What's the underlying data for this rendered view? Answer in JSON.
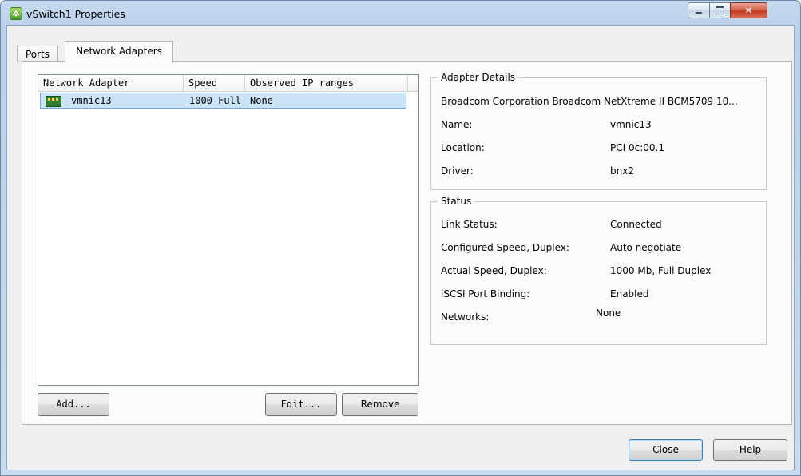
{
  "window": {
    "title": "vSwitch1 Properties"
  },
  "tabs": [
    {
      "label": "Ports",
      "selected": false
    },
    {
      "label": "Network Adapters",
      "selected": true
    }
  ],
  "adapter_list": {
    "columns": [
      "Network Adapter",
      "Speed",
      "Observed IP ranges"
    ],
    "rows": [
      {
        "adapter": "vmnic13",
        "speed": "1000 Full",
        "observed_ip": "None",
        "selected": true
      }
    ]
  },
  "list_buttons": {
    "add": "Add...",
    "edit": "Edit...",
    "remove": "Remove"
  },
  "adapter_details": {
    "title": "Adapter Details",
    "description": "Broadcom Corporation Broadcom NetXtreme II BCM5709 10...",
    "fields": [
      {
        "label": "Name:",
        "value": "vmnic13"
      },
      {
        "label": "Location:",
        "value": "PCI 0c:00.1"
      },
      {
        "label": "Driver:",
        "value": "bnx2"
      }
    ]
  },
  "status": {
    "title": "Status",
    "fields": [
      {
        "label": "Link Status:",
        "value": "Connected"
      },
      {
        "label": "Configured Speed, Duplex:",
        "value": "Auto negotiate"
      },
      {
        "label": "Actual Speed, Duplex:",
        "value": "1000 Mb, Full Duplex"
      },
      {
        "label": "iSCSI Port Binding:",
        "value": "Enabled"
      },
      {
        "label": "Networks:",
        "value": "None"
      }
    ]
  },
  "footer": {
    "close": "Close",
    "help": "Help"
  },
  "icons": {
    "app": "vswitch-icon",
    "nic": "network-card-icon"
  },
  "colors": {
    "selection": "#cce4f7",
    "close_button": "#c4381f"
  }
}
